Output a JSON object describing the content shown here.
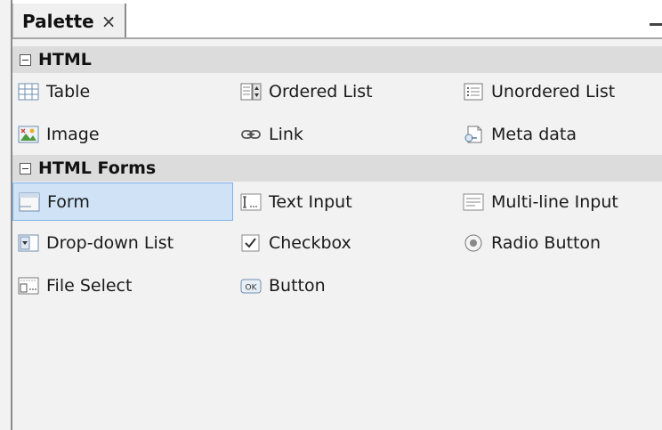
{
  "panel": {
    "tab_label": "Palette",
    "close_symbol": "×"
  },
  "categories": [
    {
      "name": "HTML",
      "items": [
        {
          "label": "Table",
          "icon": "table-icon"
        },
        {
          "label": "Ordered List",
          "icon": "ordered-list-icon"
        },
        {
          "label": "Unordered List",
          "icon": "unordered-list-icon"
        },
        {
          "label": "Image",
          "icon": "image-icon"
        },
        {
          "label": "Link",
          "icon": "link-icon"
        },
        {
          "label": "Meta data",
          "icon": "meta-data-icon"
        }
      ]
    },
    {
      "name": "HTML Forms",
      "items": [
        {
          "label": "Form",
          "icon": "form-icon",
          "selected": true
        },
        {
          "label": "Text Input",
          "icon": "text-input-icon"
        },
        {
          "label": "Multi-line Input",
          "icon": "multi-line-input-icon"
        },
        {
          "label": "Drop-down List",
          "icon": "drop-down-list-icon"
        },
        {
          "label": "Checkbox",
          "icon": "checkbox-icon"
        },
        {
          "label": "Radio Button",
          "icon": "radio-button-icon"
        },
        {
          "label": "File Select",
          "icon": "file-select-icon"
        },
        {
          "label": "Button",
          "icon": "button-icon"
        }
      ]
    }
  ]
}
